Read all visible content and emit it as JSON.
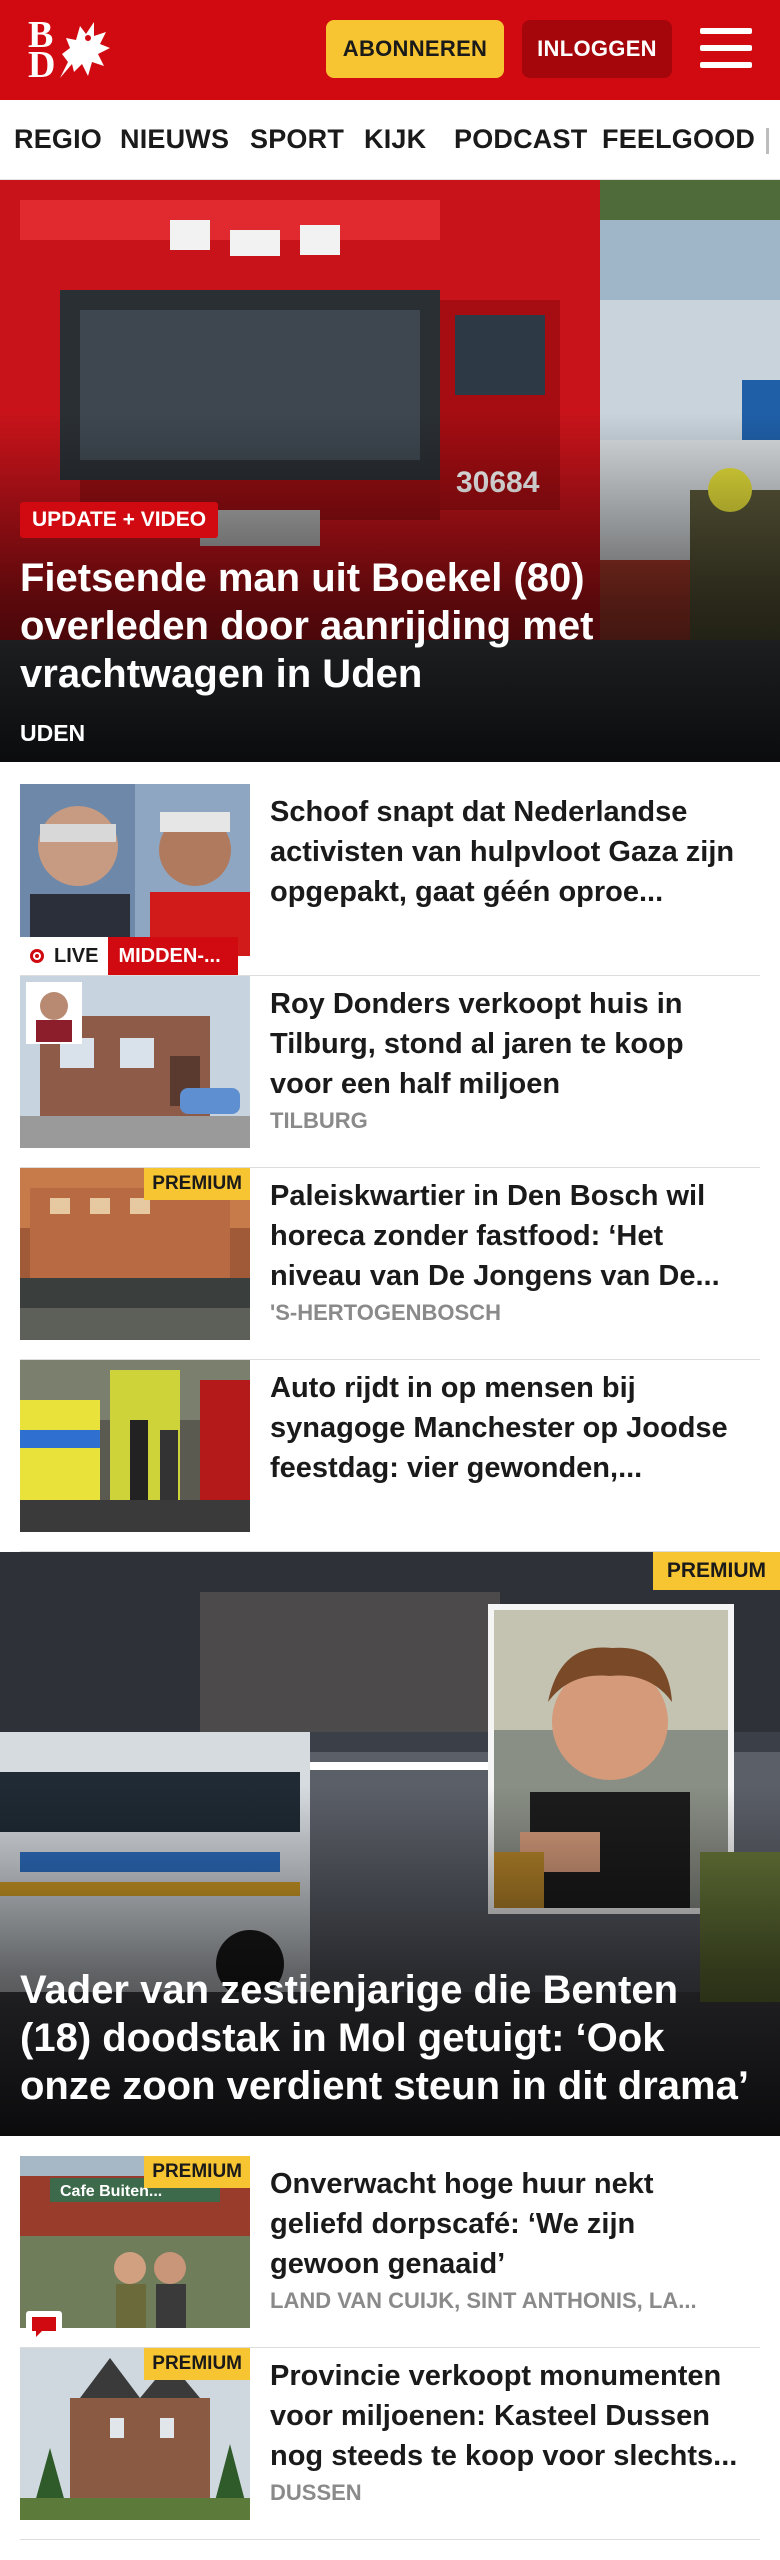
{
  "header": {
    "logo_line1": "B",
    "logo_line2": "D",
    "subscribe_label": "ABONNEREN",
    "login_label": "INLOGGEN"
  },
  "nav": {
    "items": [
      "REGIO",
      "NIEUWS",
      "SPORT",
      "KIJK",
      "PODCAST",
      "FEELGOOD"
    ]
  },
  "hero": {
    "tag": "UPDATE + VIDEO",
    "title": "Fietsende man uit Boekel (80) overleden door aanrijding met vrachtwagen in Uden",
    "location": "UDEN",
    "truck_number": "30684"
  },
  "articles": [
    {
      "title": "Schoof snapt dat Nederlandse activisten van hulpvloot Gaza zijn opgepakt, gaat géén oproe...",
      "live_label": "LIVE",
      "section_label": "MIDDEN-..."
    },
    {
      "title": "Roy Donders verkoopt huis in Tilburg, stond al jaren te koop voor een half miljoen",
      "location": "TILBURG"
    },
    {
      "title": "Paleiskwartier in Den Bosch wil horeca zonder fastfood: ‘Het niveau van De Jongens van De...",
      "location": "'S-HERTOGENBOSCH",
      "badge": "PREMIUM"
    },
    {
      "title": "Auto rijdt in op mensen bij synagoge Manchester op Joodse feestdag: vier gewonden,..."
    }
  ],
  "hero2": {
    "badge": "PREMIUM",
    "title": "Vader van zestienjarige die Benten (18) doodstak in Mol getuigt: ‘Ook onze zoon verdient steun in dit drama’"
  },
  "articles2": [
    {
      "title": "Onverwacht hoge huur nekt geliefd dorpscafé: ‘We zijn gewoon genaaid’",
      "location": "LAND VAN CUIJK, SINT ANTHONIS, LA...",
      "badge": "PREMIUM",
      "sign_text": "Cafe Buiten..."
    },
    {
      "title": "Provincie verkoopt monumenten voor miljoenen: Kasteel Dussen nog steeds te koop voor slechts...",
      "location": "DUSSEN",
      "badge": "PREMIUM"
    }
  ],
  "colors": {
    "brand_red": "#d10a11",
    "dark_red": "#a4060b",
    "premium_yellow": "#f7c531",
    "meta_gray": "#8a8a8a"
  }
}
